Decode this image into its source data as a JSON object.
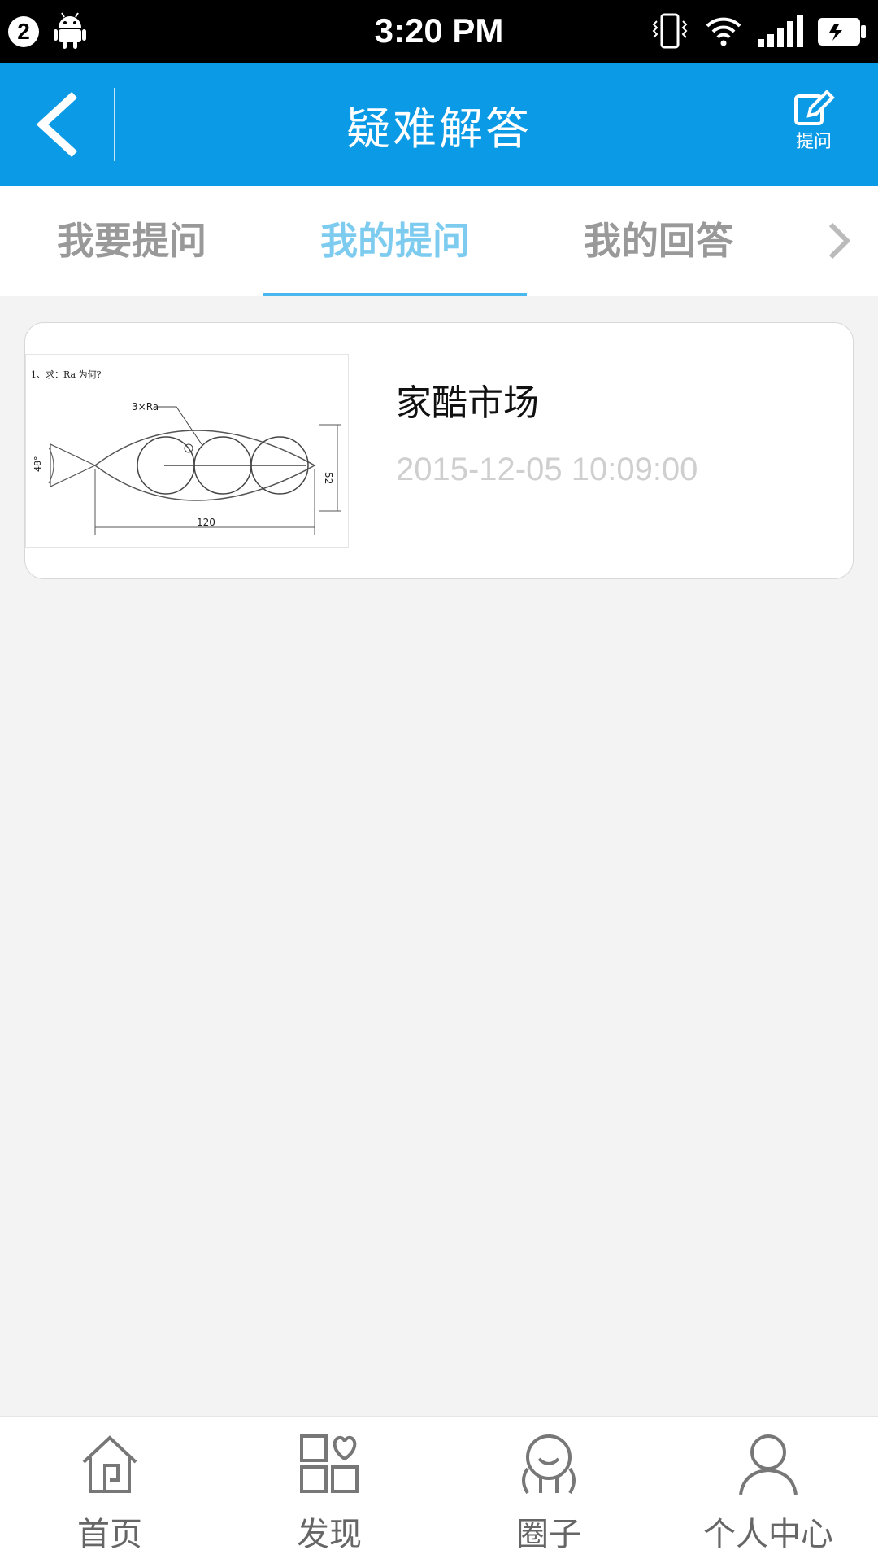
{
  "status_bar": {
    "notification_count": "2",
    "time": "3:20 PM"
  },
  "header": {
    "title": "疑难解答",
    "ask_label": "提问"
  },
  "tabs": [
    {
      "label": "我要提问"
    },
    {
      "label": "我的提问",
      "active": true
    },
    {
      "label": "我的回答"
    }
  ],
  "questions": [
    {
      "title": "家酷市场",
      "time": "2015-12-05 10:09:00",
      "thumbnail": {
        "question_text": "1、求：Ra 为何?",
        "label_radius": "3×Ra",
        "label_angle": "48°",
        "label_height": "52",
        "label_width": "120"
      }
    }
  ],
  "bottom_nav": [
    {
      "label": "首页",
      "icon": "home-icon"
    },
    {
      "label": "发现",
      "icon": "discover-icon"
    },
    {
      "label": "圈子",
      "icon": "circle-icon"
    },
    {
      "label": "个人中心",
      "icon": "person-icon"
    }
  ],
  "colors": {
    "header_bg": "#0a9ae6",
    "active_tab": "#7dccf0",
    "tab_underline": "#4ab8ef",
    "page_bg": "#f3f3f3"
  }
}
